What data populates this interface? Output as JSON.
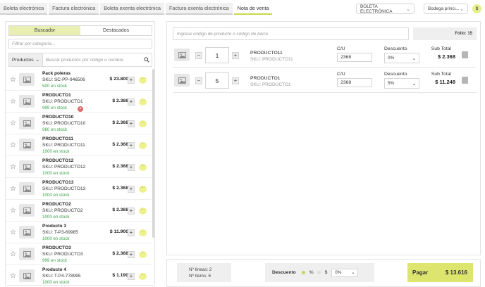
{
  "tabs": [
    {
      "label": "Boleta electrónica"
    },
    {
      "label": "Factura electrónica"
    },
    {
      "label": "Boleta exenta electrónica"
    },
    {
      "label": "Factura exenta electrónica"
    },
    {
      "label": "Nota de venta",
      "active": true
    }
  ],
  "doc_type_select": {
    "value": "BOLETA ELECTRÓNICA"
  },
  "warehouse_select": {
    "value": "Bodega princi..."
  },
  "currency_button": {
    "label": "$"
  },
  "left": {
    "segments": [
      {
        "label": "Buscador",
        "active": true
      },
      {
        "label": "Destacados"
      }
    ],
    "filter_placeholder": "Filtrar por categoría...",
    "search_scope": "Productos",
    "search_placeholder": "Buscar productos por código o nombre"
  },
  "products": [
    {
      "name": "Pack poleras",
      "sku": "SKU: SC-PP-946506",
      "stock": "500 en stock",
      "price": "$ 23.800"
    },
    {
      "name": "PRODUCTO1",
      "sku": "SKU: PRODUCTO1",
      "stock": "999 en stock",
      "price": "$ 2.368",
      "badge": "×"
    },
    {
      "name": "PRODUCTO10",
      "sku": "SKU: PRODUCTO10",
      "stock": "960 en stock",
      "price": "$ 2.368"
    },
    {
      "name": "PRODUCTO11",
      "sku": "SKU: PRODUCTO11",
      "stock": "1000 en stock",
      "price": "$ 2.368"
    },
    {
      "name": "PRODUCTO12",
      "sku": "SKU: PRODUCTO12",
      "stock": "1000 en stock",
      "price": "$ 2.368"
    },
    {
      "name": "PRODUCTO13",
      "sku": "SKU: PRODUCTO13",
      "stock": "1000 en stock",
      "price": "$ 2.368"
    },
    {
      "name": "PRODUCTO2",
      "sku": "SKU: PRODUCTO2",
      "stock": "1000 en stock",
      "price": "$ 2.368"
    },
    {
      "name": "Producto 3",
      "sku": "SKU: T-P3-69985",
      "stock": "1000 en stock",
      "price": "$ 11.900"
    },
    {
      "name": "PRODUCTO3",
      "sku": "SKU: PRODUCTO3",
      "stock": "999 en stock",
      "price": "$ 2.368"
    },
    {
      "name": "Producto 4",
      "sku": "SKU: T-P4-778995",
      "stock": "1000 en stock",
      "price": "$ 1.190"
    }
  ],
  "cart": {
    "code_placeholder": "Ingrese código de producto o código de barra",
    "folio": "Folio: 15",
    "headers": {
      "cu": "C/U",
      "discount": "Descuento",
      "subtotal": "Sub Total"
    },
    "items": [
      {
        "qty": "1",
        "name": "PRODUCTO11",
        "sku": "SKU: PRODUCTO11",
        "cu": "2368",
        "discount": "0%",
        "subtotal": "$ 2.368"
      },
      {
        "qty": "5",
        "name": "PRODUCTO1",
        "sku": "SKU: PRODUCTO1",
        "cu": "2368",
        "discount": "5%",
        "subtotal": "$ 11.248"
      }
    ]
  },
  "summary": {
    "lines": "Nº líneas: 2",
    "items": "Nº ítems: 6",
    "discount_label": "Descuento",
    "pct_symbol": "%",
    "dollar_symbol": "$",
    "discount_value": "0%",
    "pay_label": "Pagar",
    "pay_amount": "$ 13.616"
  },
  "colors": {
    "accent": "#c8d94a",
    "pay": "#dde56f",
    "stock": "#3aa24a"
  }
}
